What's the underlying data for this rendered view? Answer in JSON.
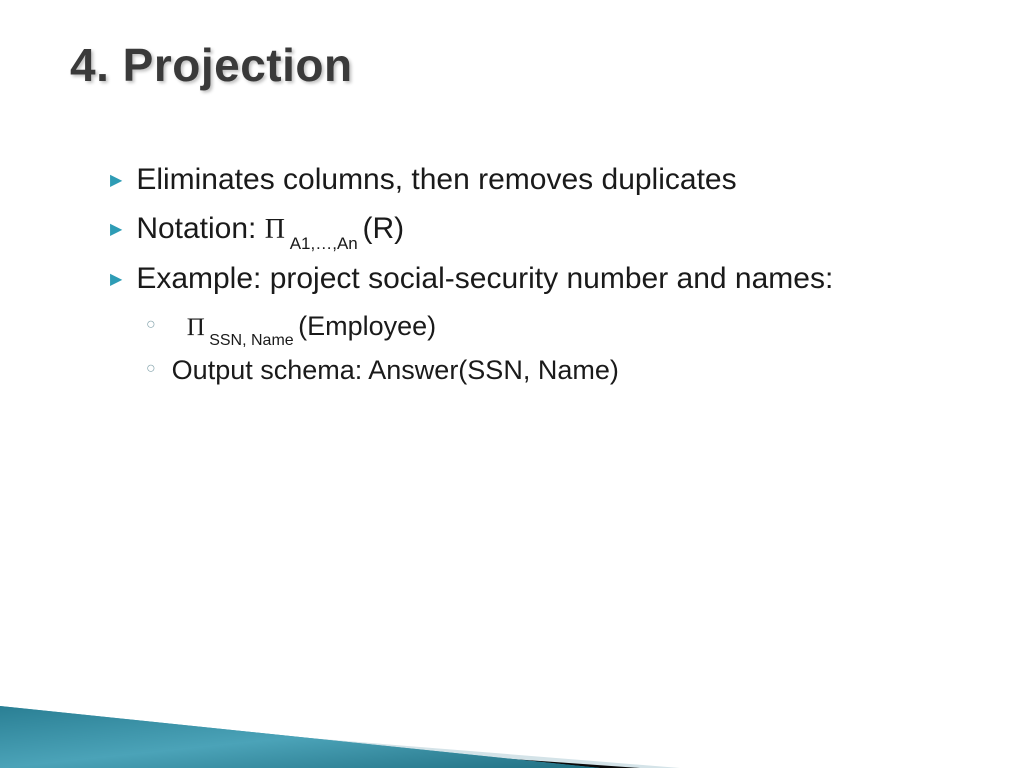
{
  "title": "4. Projection",
  "bullets": [
    {
      "text": "Eliminates columns, then removes duplicates"
    },
    {
      "prefix": "Notation:    ",
      "pi_sub": "A1,…,An",
      "suffix": "(R)"
    },
    {
      "text": "Example: project social-security number and names:"
    }
  ],
  "sub_bullets": [
    {
      "pi_sub": "SSN, Name",
      "suffix": " (Employee)"
    },
    {
      "text": "Output schema:   Answer(SSN, Name)"
    }
  ],
  "symbols": {
    "pi": "Π"
  }
}
